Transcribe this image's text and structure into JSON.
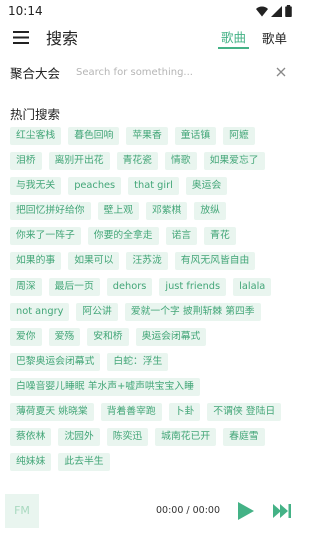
{
  "status_bar": {
    "time": "10:14"
  },
  "app_bar": {
    "title": "搜索",
    "tabs": [
      {
        "label": "歌曲",
        "active": true
      },
      {
        "label": "歌单",
        "active": false
      }
    ]
  },
  "search": {
    "source_label": "聚合大会",
    "placeholder": "Search for something...",
    "value": ""
  },
  "hot_searches": {
    "title": "热门搜索",
    "tags": [
      "红尘客栈",
      "暮色回响",
      "苹果香",
      "童话镇",
      "阿嬷",
      "泪桥",
      "离别开出花",
      "青花瓷",
      "情歌",
      "如果爱忘了",
      "与我无关",
      "peaches",
      "that girl",
      "奥运会",
      "把回忆拼好给你",
      "壁上观",
      "邓紫棋",
      "放纵",
      "你来了一阵子",
      "你要的全拿走",
      "诺言",
      "青花",
      "如果的事",
      "如果可以",
      "汪苏泷",
      "有风无风皆自由",
      "周深",
      "最后一页",
      "dehors",
      "just friends",
      "lalala",
      "not angry",
      "阿公讲",
      "爱就一个字 披荆斩棘 第四季",
      "爱你",
      "爱殇",
      "安和桥",
      "奥运会闭幕式",
      "巴黎奥运会闭幕式",
      "白蛇：浮生",
      "白噪音婴儿睡眠 羊水声+嘘声哄宝宝入睡",
      "薄荷夏天 姚晓棠",
      "背着善宰跑",
      "卜卦",
      "不谓侠 登陆日",
      "蔡依林",
      "沈园外",
      "陈奕迅",
      "城南花已开",
      "春庭雪",
      "纯妹妹",
      "此去半生"
    ]
  },
  "player": {
    "cover_text": "FM",
    "time": "00:00 / 00:00"
  },
  "colors": {
    "accent": "#44b286",
    "tag_background": "#e9f5ef",
    "tag_text": "#43a678"
  },
  "icons": {
    "menu": "hamburger-menu-icon",
    "clear": "close-icon",
    "play": "play-icon",
    "next": "skip-next-icon",
    "wifi": "wifi-icon",
    "signal": "signal-icon",
    "battery": "battery-icon"
  }
}
